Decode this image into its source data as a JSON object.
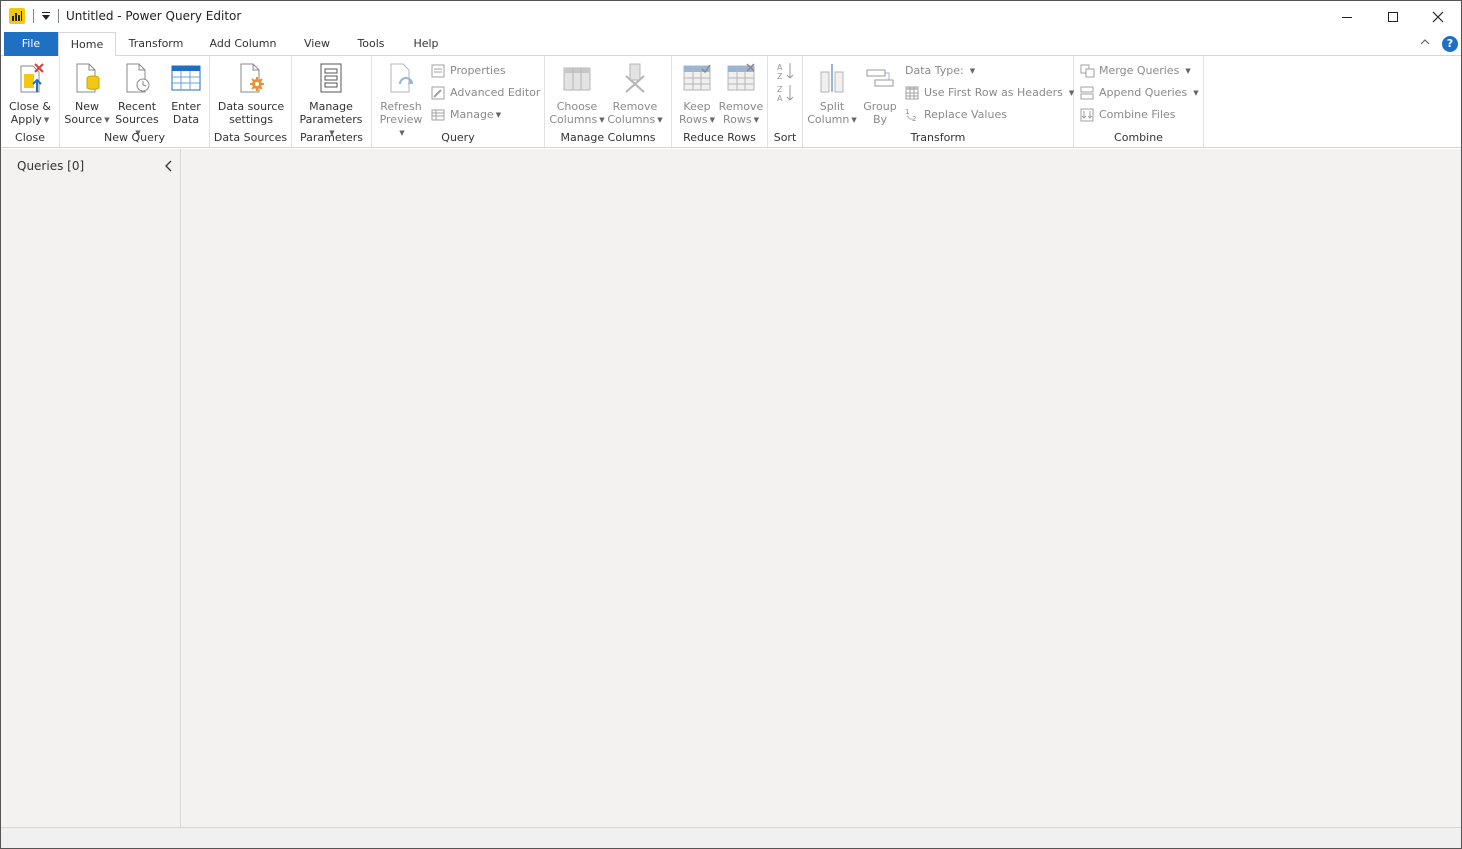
{
  "window": {
    "title": "Untitled - Power Query Editor"
  },
  "tabs": [
    {
      "label": "File"
    },
    {
      "label": "Home"
    },
    {
      "label": "Transform"
    },
    {
      "label": "Add Column"
    },
    {
      "label": "View"
    },
    {
      "label": "Tools"
    },
    {
      "label": "Help"
    }
  ],
  "help_label": "?",
  "ribbon": {
    "close": {
      "group": "Close",
      "close_apply": [
        "Close &",
        "Apply"
      ]
    },
    "new_query": {
      "group": "New Query",
      "new_source": [
        "New",
        "Source"
      ],
      "recent_sources": [
        "Recent",
        "Sources"
      ],
      "enter_data": [
        "Enter",
        "Data"
      ]
    },
    "data_sources": {
      "group": "Data Sources",
      "settings": [
        "Data source",
        "settings"
      ]
    },
    "parameters": {
      "group": "Parameters",
      "manage": [
        "Manage",
        "Parameters"
      ]
    },
    "query": {
      "group": "Query",
      "refresh": [
        "Refresh",
        "Preview"
      ],
      "properties": "Properties",
      "advanced_editor": "Advanced Editor",
      "manage": "Manage"
    },
    "manage_columns": {
      "group": "Manage Columns",
      "choose": [
        "Choose",
        "Columns"
      ],
      "remove": [
        "Remove",
        "Columns"
      ]
    },
    "reduce_rows": {
      "group": "Reduce Rows",
      "keep": [
        "Keep",
        "Rows"
      ],
      "remove": [
        "Remove",
        "Rows"
      ]
    },
    "sort": {
      "group": "Sort"
    },
    "transform": {
      "group": "Transform",
      "split": [
        "Split",
        "Column"
      ],
      "group_by": [
        "Group",
        "By"
      ],
      "data_type": "Data Type:",
      "first_row": "Use First Row as Headers",
      "replace": "Replace Values"
    },
    "combine": {
      "group": "Combine",
      "merge": "Merge Queries",
      "append": "Append Queries",
      "combine_files": "Combine Files"
    }
  },
  "queries_pane": {
    "title": "Queries [0]"
  },
  "colors": {
    "accent": "#1f6fc3",
    "logo": "#f2c811",
    "close_x": "#d83b3b",
    "gear": "#e8923a"
  }
}
